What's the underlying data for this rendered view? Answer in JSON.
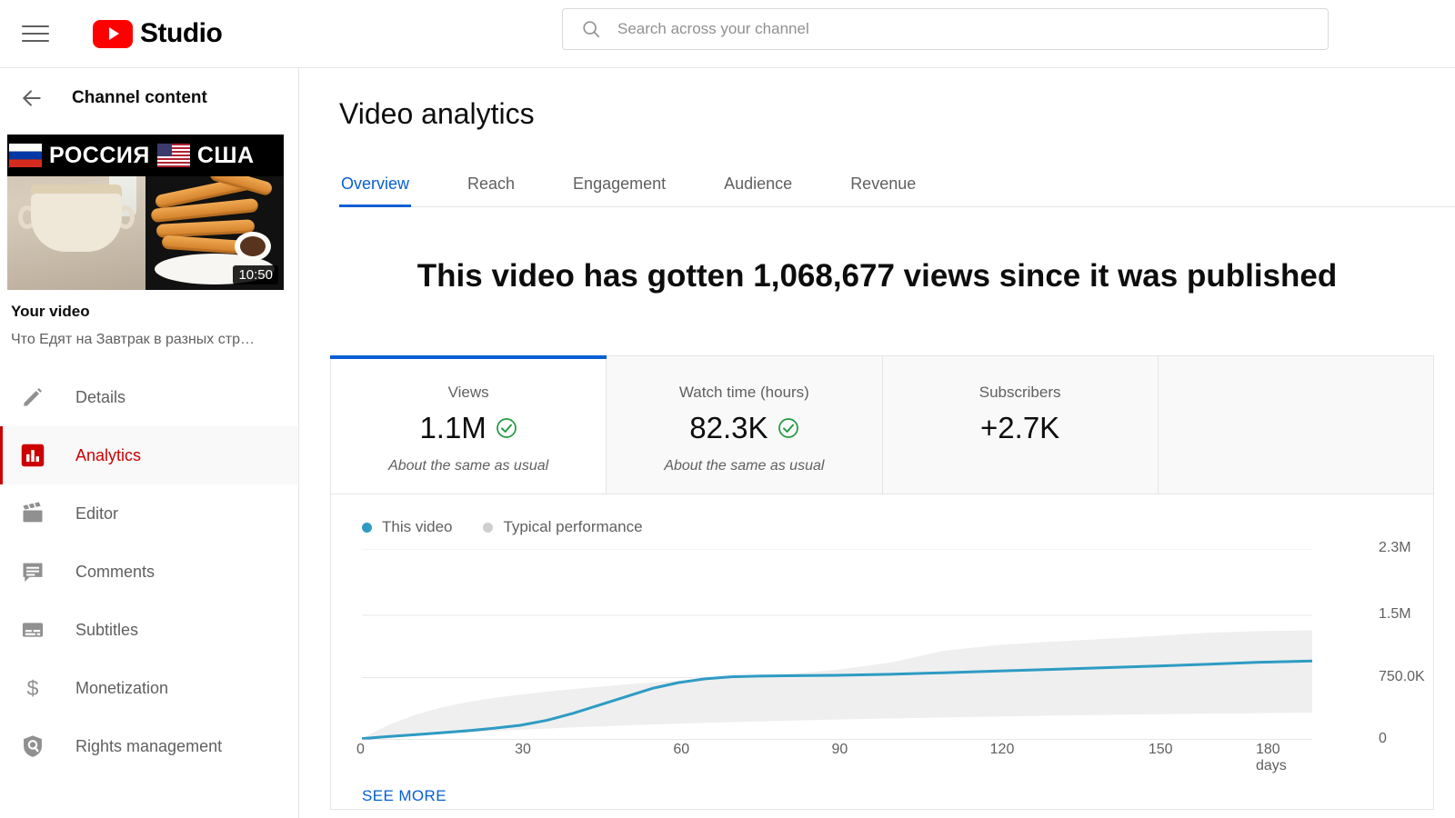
{
  "header": {
    "menu_icon": "hamburger-icon",
    "logo_icon": "youtube-play-icon",
    "brand": "Studio",
    "search": {
      "placeholder": "Search across your channel",
      "value": "",
      "icon": "search-icon"
    }
  },
  "sidebar": {
    "back_label": "Channel content",
    "back_icon": "arrow-left-icon",
    "thumbnail": {
      "left_country": "РОССИЯ",
      "right_country": "США",
      "left_flag_icon": "russia-flag-icon",
      "right_flag_icon": "usa-flag-icon",
      "duration": "10:50"
    },
    "video_label": "Your video",
    "video_title": "Что Едят на Завтрак в разных стр…",
    "items": [
      {
        "label": "Details",
        "icon": "pencil-icon",
        "active": false
      },
      {
        "label": "Analytics",
        "icon": "bar-chart-icon",
        "active": true
      },
      {
        "label": "Editor",
        "icon": "clapperboard-icon",
        "active": false
      },
      {
        "label": "Comments",
        "icon": "comment-icon",
        "active": false
      },
      {
        "label": "Subtitles",
        "icon": "subtitles-icon",
        "active": false
      },
      {
        "label": "Monetization",
        "icon": "dollar-icon",
        "active": false
      },
      {
        "label": "Rights management",
        "icon": "shield-icon",
        "active": false
      }
    ]
  },
  "main": {
    "page_title": "Video analytics",
    "tabs": [
      {
        "label": "Overview",
        "active": true
      },
      {
        "label": "Reach",
        "active": false
      },
      {
        "label": "Engagement",
        "active": false
      },
      {
        "label": "Audience",
        "active": false
      },
      {
        "label": "Revenue",
        "active": false
      }
    ],
    "headline": "This video has gotten 1,068,677 views since it was published",
    "metrics": [
      {
        "label": "Views",
        "value": "1.1M",
        "subtitle": "About the same as usual",
        "check": true,
        "selected": true
      },
      {
        "label": "Watch time (hours)",
        "value": "82.3K",
        "subtitle": "About the same as usual",
        "check": true,
        "selected": false
      },
      {
        "label": "Subscribers",
        "value": "+2.7K",
        "subtitle": "",
        "check": false,
        "selected": false
      },
      {
        "label": "",
        "value": "",
        "subtitle": "",
        "check": false,
        "selected": false
      }
    ],
    "see_more": "SEE MORE"
  },
  "colors": {
    "brand_red": "#ff0000",
    "accent_blue": "#065fd4",
    "series_blue": "#2e9bc4",
    "band_gray": "#efefef",
    "check_green": "#1d9a3c",
    "active_red": "#cc0000"
  },
  "chart_data": {
    "type": "line",
    "title": "",
    "xlabel": "days",
    "ylabel": "",
    "grid": true,
    "legend_position": "top-left",
    "legend": [
      "This video",
      "Typical performance"
    ],
    "xlim": [
      0,
      180
    ],
    "ylim": [
      0,
      2300000
    ],
    "xticks": [
      0,
      30,
      60,
      90,
      120,
      150,
      180
    ],
    "xtick_labels": [
      "0",
      "30",
      "60",
      "90",
      "120",
      "150",
      "180 days"
    ],
    "yticks": [
      0,
      750000,
      1500000,
      2300000
    ],
    "ytick_labels": [
      "0",
      "750.0K",
      "1.5M",
      "2.3M"
    ],
    "x": [
      0,
      5,
      10,
      15,
      20,
      25,
      30,
      35,
      40,
      45,
      50,
      55,
      60,
      65,
      70,
      75,
      80,
      90,
      100,
      110,
      120,
      130,
      140,
      150,
      160,
      170,
      180
    ],
    "series": [
      {
        "name": "This video",
        "color": "#2e9bc4",
        "values": [
          15000,
          40000,
          62000,
          85000,
          110000,
          140000,
          175000,
          235000,
          320000,
          420000,
          520000,
          620000,
          690000,
          735000,
          760000,
          768000,
          772000,
          778000,
          790000,
          808000,
          828000,
          848000,
          868000,
          888000,
          910000,
          935000,
          950000
        ]
      },
      {
        "name": "Typical performance",
        "color": "#efefef",
        "type": "band",
        "upper": [
          20000,
          180000,
          300000,
          390000,
          455000,
          505000,
          545000,
          580000,
          612000,
          640000,
          668000,
          692000,
          712000,
          730000,
          748000,
          768000,
          790000,
          845000,
          930000,
          1070000,
          1140000,
          1180000,
          1215000,
          1250000,
          1290000,
          1310000,
          1320000
        ],
        "lower": [
          0,
          20000,
          45000,
          68000,
          88000,
          106000,
          122000,
          136000,
          150000,
          162000,
          174000,
          185000,
          195000,
          205000,
          214000,
          222000,
          230000,
          245000,
          258000,
          270000,
          281000,
          291000,
          300000,
          308000,
          316000,
          322000,
          328000
        ]
      }
    ]
  }
}
